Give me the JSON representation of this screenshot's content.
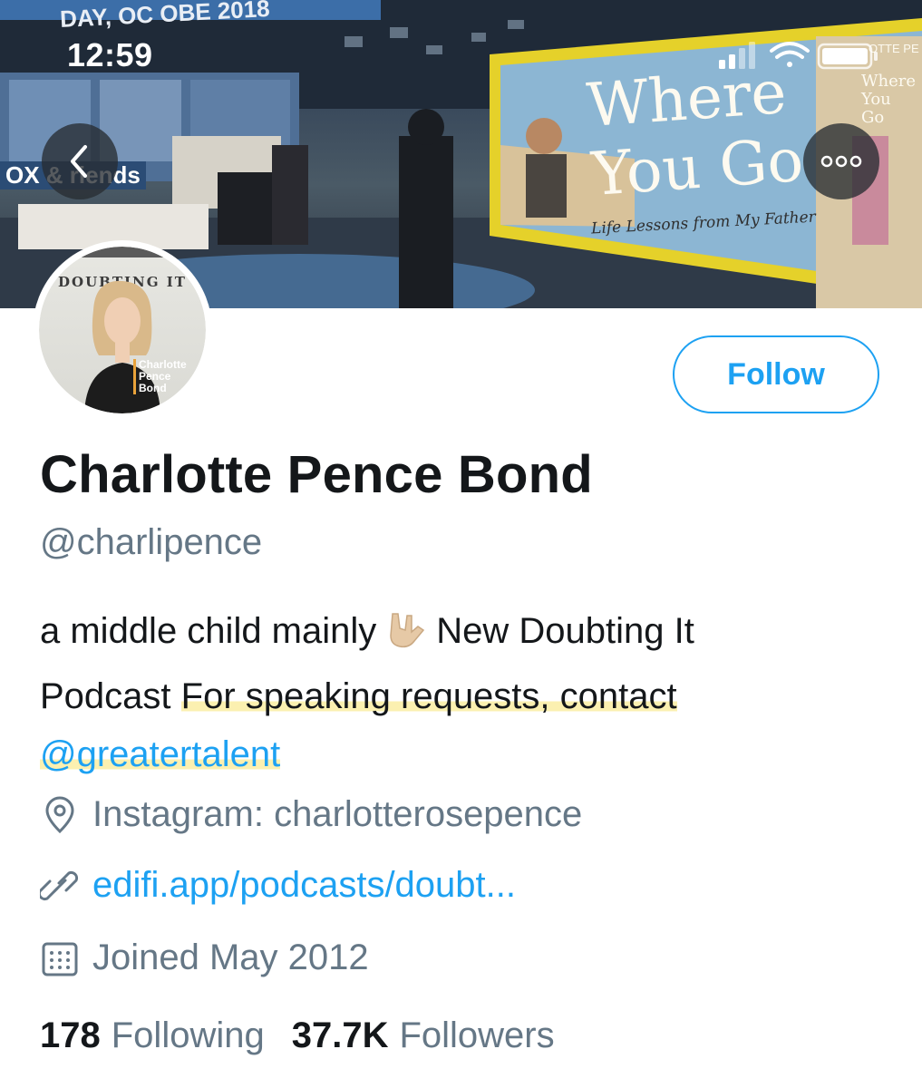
{
  "status_bar": {
    "time": "12:59",
    "icons": [
      "signal-icon",
      "wifi-icon",
      "battery-icon"
    ]
  },
  "banner": {
    "ticker_text": "DAY, OC OBE 2018",
    "show_logo": "OX & riends",
    "book_title_line1": "Where",
    "book_title_line2": "You Go",
    "book_subtitle": "Life Lessons from My Father",
    "mini_title": "Where You Go",
    "mini_header": "OTTE PE"
  },
  "nav": {
    "back_icon": "chevron-left-icon",
    "more_icon": "more-horizontal-icon"
  },
  "avatar": {
    "podcast_title": "DOUBTING IT",
    "name_lines": [
      "Charlotte",
      "Pence",
      "Bond"
    ]
  },
  "follow_button": {
    "label": "Follow"
  },
  "profile": {
    "display_name": "Charlotte Pence Bond",
    "handle": "@charlipence",
    "bio": {
      "part1": "a middle child mainly",
      "emoji": "🤟🏼",
      "part2": "New Doubting It",
      "part3": "Podcast",
      "highlighted": "For speaking requests, contact",
      "mention": "@greatertalent"
    },
    "location": "Instagram: charlotterosepence",
    "website": "edifi.app/podcasts/doubt...",
    "joined": "Joined May 2012"
  },
  "stats": {
    "following_count": "178",
    "following_label": "Following",
    "followers_count": "37.7K",
    "followers_label": "Followers"
  },
  "colors": {
    "accent": "#1da1f2",
    "text_primary": "#14171a",
    "text_secondary": "#657786",
    "highlight": "#faeb96"
  }
}
